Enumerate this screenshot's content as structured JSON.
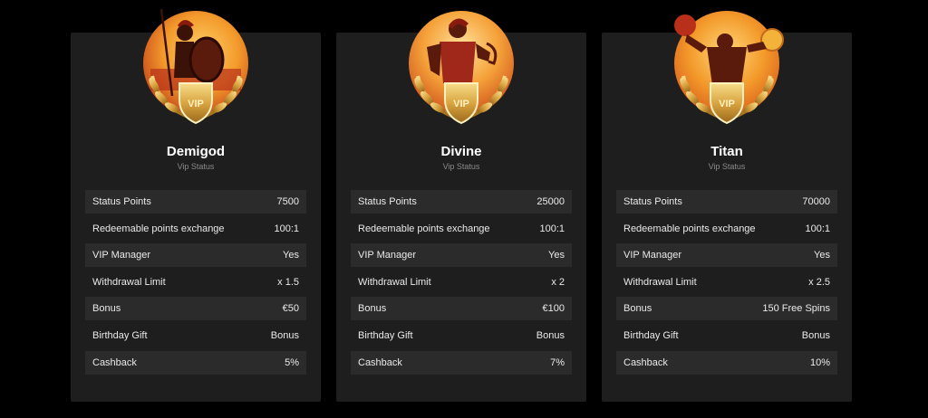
{
  "tiers": [
    {
      "name": "Demigod",
      "subtitle": "Vip Status",
      "emblem": "spartan-warrior-vip-icon",
      "rows": [
        {
          "label": "Status Points",
          "value": "7500"
        },
        {
          "label": "Redeemable points exchange",
          "value": "100:1"
        },
        {
          "label": "VIP Manager",
          "value": "Yes"
        },
        {
          "label": "Withdrawal Limit",
          "value": "x 1.5"
        },
        {
          "label": "Bonus",
          "value": "€50"
        },
        {
          "label": "Birthday Gift",
          "value": "Bonus"
        },
        {
          "label": "Cashback",
          "value": "5%"
        }
      ]
    },
    {
      "name": "Divine",
      "subtitle": "Vip Status",
      "emblem": "god-with-lyre-vip-icon",
      "rows": [
        {
          "label": "Status Points",
          "value": "25000"
        },
        {
          "label": "Redeemable points exchange",
          "value": "100:1"
        },
        {
          "label": "VIP Manager",
          "value": "Yes"
        },
        {
          "label": "Withdrawal Limit",
          "value": "x 2"
        },
        {
          "label": "Bonus",
          "value": "€100"
        },
        {
          "label": "Birthday Gift",
          "value": "Bonus"
        },
        {
          "label": "Cashback",
          "value": "7%"
        }
      ]
    },
    {
      "name": "Titan",
      "subtitle": "Vip Status",
      "emblem": "titan-holding-spheres-vip-icon",
      "rows": [
        {
          "label": "Status Points",
          "value": "70000"
        },
        {
          "label": "Redeemable points exchange",
          "value": "100:1"
        },
        {
          "label": "VIP Manager",
          "value": "Yes"
        },
        {
          "label": "Withdrawal Limit",
          "value": "x 2.5"
        },
        {
          "label": "Bonus",
          "value": "150 Free Spins"
        },
        {
          "label": "Birthday Gift",
          "value": "Bonus"
        },
        {
          "label": "Cashback",
          "value": "10%"
        }
      ]
    }
  ],
  "badge_text": "VIP",
  "colors": {
    "page_bg": "#000000",
    "card_bg": "#1e1e1e",
    "row_alt_bg": "#2b2b2b",
    "text_primary": "#ffffff",
    "text_muted": "#8a8a8a",
    "gold": "#d9a441",
    "orange_sky": "#f39a2b"
  }
}
